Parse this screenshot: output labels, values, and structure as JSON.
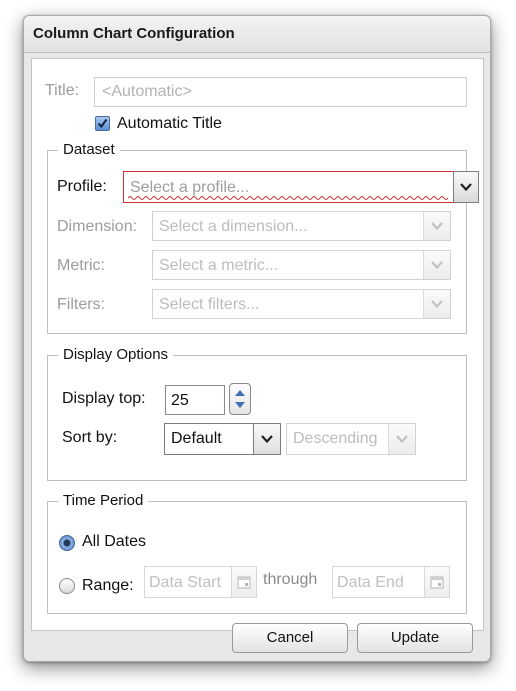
{
  "dialog": {
    "title": "Column Chart Configuration"
  },
  "title_field": {
    "label": "Title:",
    "placeholder": "<Automatic>",
    "automatic_checkbox_label": "Automatic Title",
    "automatic_checked": true
  },
  "dataset": {
    "legend": "Dataset",
    "profile": {
      "label": "Profile:",
      "placeholder": "Select a profile..."
    },
    "dimension": {
      "label": "Dimension:",
      "placeholder": "Select a dimension..."
    },
    "metric": {
      "label": "Metric:",
      "placeholder": "Select a metric..."
    },
    "filters": {
      "label": "Filters:",
      "placeholder": "Select filters..."
    }
  },
  "display_options": {
    "legend": "Display Options",
    "display_top_label": "Display top:",
    "display_top_value": "25",
    "sort_by_label": "Sort by:",
    "sort_by_value": "Default",
    "sort_order_value": "Descending"
  },
  "time_period": {
    "legend": "Time Period",
    "all_dates_label": "All Dates",
    "all_dates_selected": true,
    "range_label": "Range:",
    "range_start_placeholder": "Data Start",
    "through_label": "through",
    "range_end_placeholder": "Data End"
  },
  "footer": {
    "cancel_label": "Cancel",
    "update_label": "Update"
  },
  "icons": {
    "dropdown": "chevron-down-icon",
    "calendar": "calendar-icon",
    "spinner": "stepper-arrows-icon",
    "checkmark": "checkmark-icon"
  },
  "colors": {
    "validation_error": "#cc3333",
    "selection_blue": "#5c8fd4"
  }
}
